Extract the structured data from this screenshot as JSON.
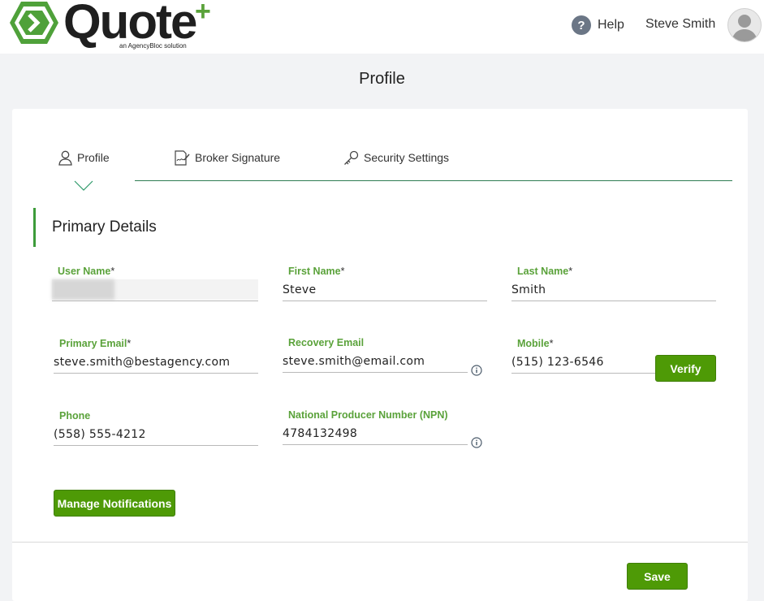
{
  "header": {
    "logo_word": "Quote",
    "logo_plus": "+",
    "logo_tagline": "an AgencyBloc solution",
    "help_label": "Help",
    "user_name": "Steve Smith"
  },
  "page_title": "Profile",
  "tabs": [
    {
      "label": "Profile",
      "icon": "user-icon",
      "active": true
    },
    {
      "label": "Broker Signature",
      "icon": "signature-icon"
    },
    {
      "label": "Security Settings",
      "icon": "key-icon"
    }
  ],
  "section_title": "Primary Details",
  "fields": {
    "username": {
      "label": "User Name",
      "required": "*",
      "value": ""
    },
    "first_name": {
      "label": "First Name",
      "required": "*",
      "value": "Steve"
    },
    "last_name": {
      "label": "Last Name",
      "required": "*",
      "value": "Smith"
    },
    "primary_email": {
      "label": "Primary Email",
      "required": "*",
      "value": "steve.smith@bestagency.com"
    },
    "recovery_email": {
      "label": "Recovery Email",
      "required": "",
      "value": "steve.smith@email.com"
    },
    "mobile": {
      "label": "Mobile",
      "required": "*",
      "value": "(515) 123-6546"
    },
    "phone": {
      "label": "Phone",
      "required": "",
      "value": "(558) 555-4212"
    },
    "npn": {
      "label": "National Producer Number (NPN)",
      "required": "",
      "value": "4784132498"
    }
  },
  "buttons": {
    "verify": "Verify",
    "manage_notifications": "Manage Notifications",
    "save": "Save"
  },
  "colors": {
    "accent_green": "#4e9a06",
    "label_green": "#5aa23a",
    "tab_line": "#2e7d52"
  }
}
